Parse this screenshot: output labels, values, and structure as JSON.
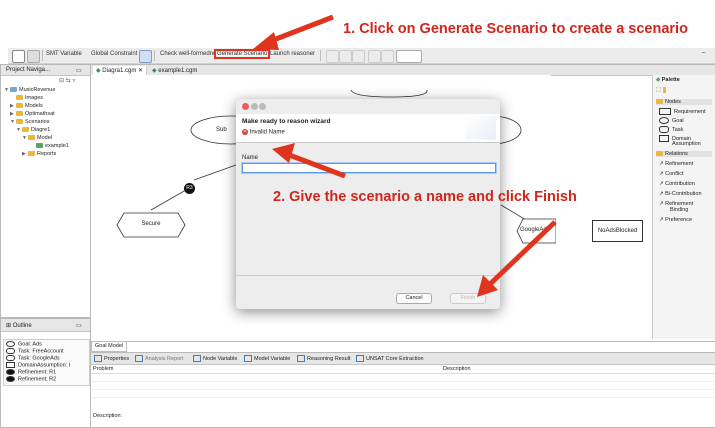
{
  "annotations": {
    "step1": "1. Click on Generate Scenario to create a scenario",
    "step2": "2. Give the scenario a name and click Finish"
  },
  "toolbar": {
    "smt_variable": "SMT Variable",
    "global_constraint": "Global Constraint",
    "check_wellformedness": "Check well-formedness",
    "generate_scenario": "Generate Scenario",
    "launch_reasoner": "Launch reasoner"
  },
  "project_navigator": {
    "tab_label": "Project Naviga...",
    "items": [
      {
        "label": "MusicRevenue"
      },
      {
        "label": "Images"
      },
      {
        "label": "Models"
      },
      {
        "label": "Optimathsat"
      },
      {
        "label": "Scenarios"
      },
      {
        "label": "Diagre1"
      },
      {
        "label": "Model"
      },
      {
        "label": "example1"
      },
      {
        "label": "Reports"
      }
    ]
  },
  "editor": {
    "tabs": [
      {
        "label": "Diagra1.cgm"
      },
      {
        "label": "example1.cgm"
      }
    ],
    "nodes": {
      "r3": "R3",
      "secure": "Secure",
      "google_ads": "GoogleAds",
      "no_ads_blocked": "NoAdsBlocked",
      "sub_left_fragment": "Sub",
      "right_fragment": "s"
    },
    "bottom_tab": "Goal Model"
  },
  "palette": {
    "title": "Palette",
    "nodes_header": "Nodes",
    "nodes": [
      "Requirement",
      "Goal",
      "Task",
      "Domain",
      "Assumption"
    ],
    "relations_header": "Relations",
    "relations": [
      "Refinement",
      "Conflict",
      "Contribution",
      "Bi-Contribution",
      "Refinement",
      "Binding",
      "Preference"
    ]
  },
  "dialog": {
    "title": "Make ready to reason wizard",
    "error_text": "Invalid Name",
    "name_label": "Name",
    "name_value": "",
    "cancel_label": "Cancel",
    "finish_label": "Finish"
  },
  "outline": {
    "tab_label": "Outline",
    "items": [
      "Goal: Ads",
      "Task: FreeAccount",
      "Task: GoogleAds",
      "DomainAssumption: I",
      "Refinement: R1",
      "Refinement: R2"
    ]
  },
  "bottom_panel": {
    "tabs": [
      "Properties",
      "Analysis Report",
      "Node Variable",
      "Model Variable",
      "Reasoning Result",
      "UNSAT Core Extraction"
    ],
    "columns": [
      "Problem",
      "Description"
    ],
    "description_label": "Description:"
  },
  "colors": {
    "annotation_red": "#d0261c",
    "highlight_box": "#e0341f",
    "dialog_bg": "#ededed",
    "focus_blue": "#5b9be6"
  }
}
